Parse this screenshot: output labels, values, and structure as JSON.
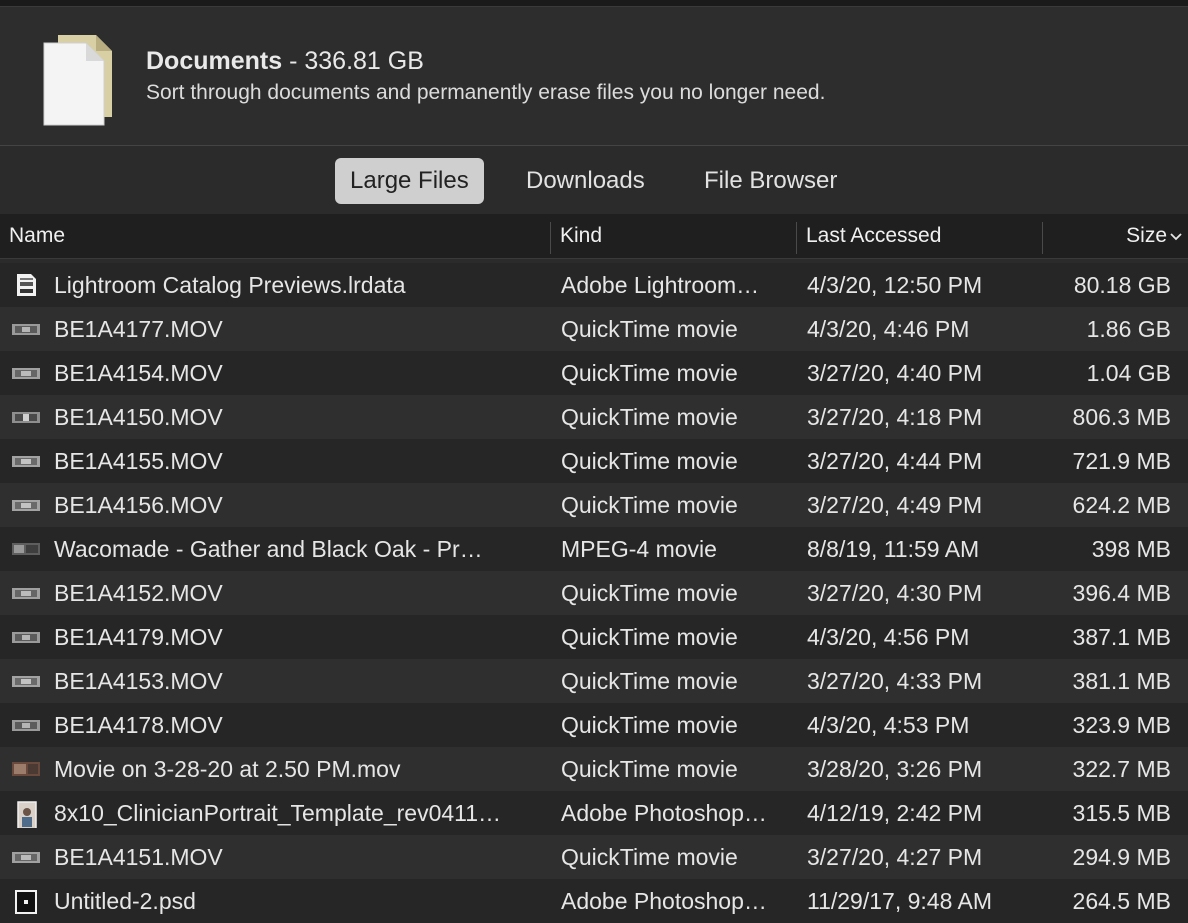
{
  "header": {
    "title": "Documents",
    "separator": " - ",
    "size": "336.81 GB",
    "subtitle": "Sort through documents and permanently erase files you no longer need."
  },
  "tabs": [
    {
      "label": "Large Files",
      "active": true
    },
    {
      "label": "Downloads",
      "active": false
    },
    {
      "label": "File Browser",
      "active": false
    }
  ],
  "columns": {
    "name": "Name",
    "kind": "Kind",
    "last_accessed": "Last Accessed",
    "size": "Size",
    "sort_icon": "chevron-down-icon"
  },
  "rows": [
    {
      "icon": "lrdata-file-icon",
      "name": "Lightroom Catalog Previews.lrdata",
      "kind": "Adobe Lightroom…",
      "date": "4/3/20, 12:50 PM",
      "size": "80.18 GB"
    },
    {
      "icon": "video-thumbnail-icon",
      "name": "BE1A4177.MOV",
      "kind": "QuickTime movie",
      "date": "4/3/20, 4:46 PM",
      "size": "1.86 GB"
    },
    {
      "icon": "video-thumbnail-icon",
      "name": "BE1A4154.MOV",
      "kind": "QuickTime movie",
      "date": "3/27/20, 4:40 PM",
      "size": "1.04 GB"
    },
    {
      "icon": "video-thumbnail-icon",
      "name": "BE1A4150.MOV",
      "kind": "QuickTime movie",
      "date": "3/27/20, 4:18 PM",
      "size": "806.3 MB"
    },
    {
      "icon": "video-thumbnail-icon",
      "name": "BE1A4155.MOV",
      "kind": "QuickTime movie",
      "date": "3/27/20, 4:44 PM",
      "size": "721.9 MB"
    },
    {
      "icon": "video-thumbnail-icon",
      "name": "BE1A4156.MOV",
      "kind": "QuickTime movie",
      "date": "3/27/20, 4:49 PM",
      "size": "624.2 MB"
    },
    {
      "icon": "video-thumbnail-icon",
      "name": "Wacomade - Gather and Black Oak - Pr…",
      "kind": "MPEG-4 movie",
      "date": "8/8/19, 11:59 AM",
      "size": "398 MB"
    },
    {
      "icon": "video-thumbnail-icon",
      "name": "BE1A4152.MOV",
      "kind": "QuickTime movie",
      "date": "3/27/20, 4:30 PM",
      "size": "396.4 MB"
    },
    {
      "icon": "video-thumbnail-icon",
      "name": "BE1A4179.MOV",
      "kind": "QuickTime movie",
      "date": "4/3/20, 4:56 PM",
      "size": "387.1 MB"
    },
    {
      "icon": "video-thumbnail-icon",
      "name": "BE1A4153.MOV",
      "kind": "QuickTime movie",
      "date": "3/27/20, 4:33 PM",
      "size": "381.1 MB"
    },
    {
      "icon": "video-thumbnail-icon",
      "name": "BE1A4178.MOV",
      "kind": "QuickTime movie",
      "date": "4/3/20, 4:53 PM",
      "size": "323.9 MB"
    },
    {
      "icon": "video-thumbnail-icon",
      "name": "Movie on 3-28-20 at 2.50 PM.mov",
      "kind": "QuickTime movie",
      "date": "3/28/20, 3:26 PM",
      "size": "322.7 MB"
    },
    {
      "icon": "portrait-thumbnail-icon",
      "name": "8x10_ClinicianPortrait_Template_rev0411…",
      "kind": "Adobe Photoshop…",
      "date": "4/12/19, 2:42 PM",
      "size": "315.5 MB"
    },
    {
      "icon": "video-thumbnail-icon",
      "name": "BE1A4151.MOV",
      "kind": "QuickTime movie",
      "date": "3/27/20, 4:27 PM",
      "size": "294.9 MB"
    },
    {
      "icon": "psd-thumbnail-icon",
      "name": "Untitled-2.psd",
      "kind": "Adobe Photoshop…",
      "date": "11/29/17, 9:48 AM",
      "size": "264.5 MB"
    }
  ],
  "colors": {
    "background": "#2b2b2b",
    "active_tab": "#cfcfcf",
    "row_odd": "#262626",
    "row_even": "#2f2f2f"
  }
}
